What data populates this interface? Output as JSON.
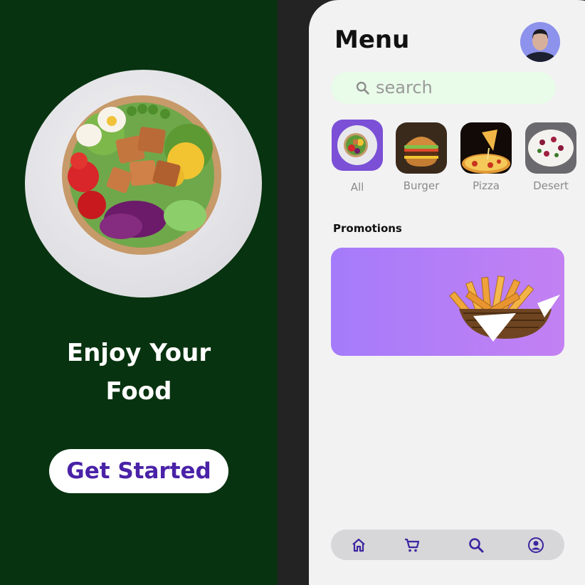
{
  "onboarding": {
    "title_line1": "Enjoy Your",
    "title_line2": "Food",
    "cta_label": "Get Started"
  },
  "menu": {
    "title": "Menu",
    "search_placeholder": "search",
    "categories": [
      {
        "label": "All",
        "icon": "salad-bowl-image",
        "selected": true
      },
      {
        "label": "Burger",
        "icon": "burger-image",
        "selected": false
      },
      {
        "label": "Pizza",
        "icon": "pizza-image",
        "selected": false
      },
      {
        "label": "Desert",
        "icon": "cake-image",
        "selected": false
      }
    ],
    "promotions_title": "Promotions",
    "promo_image": "french-fries-basket"
  },
  "bottom_nav": {
    "items": [
      "home-icon",
      "cart-icon",
      "search-icon",
      "profile-icon"
    ]
  },
  "colors": {
    "background": "#232323",
    "onboarding_bg": "#083310",
    "accent": "#4a22a8",
    "search_bg": "#e9fbe9",
    "promo_gradient_start": "#a57bfb",
    "promo_gradient_end": "#c381f2",
    "nav_bg": "#d7d7d9"
  }
}
